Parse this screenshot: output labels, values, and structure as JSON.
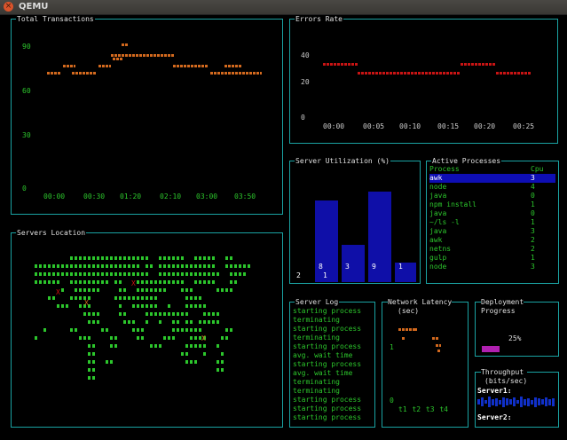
{
  "window": {
    "title": "QEMU",
    "close_icon": "close-icon"
  },
  "total_transactions": {
    "title": "Total Transactions",
    "y_ticks": [
      "90",
      "60",
      "30",
      "0"
    ],
    "x_ticks": [
      "00:00",
      "00:30",
      "01:20",
      "02:10",
      "03:00",
      "03:50"
    ]
  },
  "errors_rate": {
    "title": "Errors Rate",
    "y_ticks": [
      "40",
      "20",
      "0"
    ],
    "x_ticks": [
      "00:00",
      "00:05",
      "00:10",
      "00:15",
      "00:20",
      "00:25"
    ]
  },
  "servers_location": {
    "title": "Servers Location",
    "marker": "X"
  },
  "server_utilization": {
    "title": "Server Utilization (%)",
    "values_label": [
      "2",
      "1"
    ],
    "bar_labels": [
      "8",
      "3",
      "9",
      "1"
    ]
  },
  "active_processes": {
    "title": "Active Processes",
    "headers": [
      "Process",
      "Cpu"
    ],
    "rows": [
      [
        "awk",
        "3"
      ],
      [
        "node",
        "4"
      ],
      [
        "java",
        "0"
      ],
      [
        "npm install",
        "1"
      ],
      [
        "java",
        "0"
      ],
      [
        "~/ls -l",
        "1"
      ],
      [
        "java",
        "3"
      ],
      [
        "awk",
        "2"
      ],
      [
        "netns",
        "2"
      ],
      [
        "gulp",
        "1"
      ],
      [
        "node",
        "3"
      ]
    ]
  },
  "server_log": {
    "title": "Server Log",
    "lines": [
      "starting process",
      "terminating",
      "starting process",
      "terminating",
      "starting process",
      "avg. wait time",
      "starting process",
      "avg. wait time",
      "terminating",
      "terminating",
      "starting process",
      "starting process",
      "starting process"
    ]
  },
  "network_latency": {
    "title1": "Network Latency",
    "title2": "(sec)",
    "y_ticks": [
      "1",
      "0"
    ],
    "x_ticks": "t1 t2 t3 t4"
  },
  "deployment": {
    "title1": "Deployment",
    "title2": "Progress",
    "percent_label": "25%",
    "progress": 0.25
  },
  "throughput": {
    "title1": "Throughput",
    "title2": "(bits/sec)",
    "server1": "Server1:",
    "server2": "Server2:"
  },
  "colors": {
    "border": "#1aa3a3",
    "green": "#2cc62c",
    "orange": "#d2691e",
    "red": "#c81414",
    "blue": "#0f0fa8",
    "selected": "#0e0eb4",
    "magenta": "#b020b0"
  }
}
